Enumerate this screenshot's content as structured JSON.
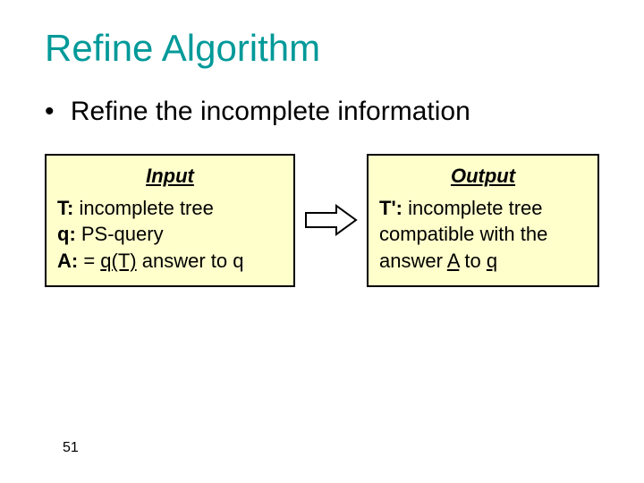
{
  "title": "Refine Algorithm",
  "bullet": "Refine the incomplete information",
  "input": {
    "header": "Input",
    "line1_prefix": "T:",
    "line1_rest": " incomplete tree",
    "line2_prefix": "q:",
    "line2_rest": " PS-query",
    "line3_prefix": "A:",
    "line3_eq": " = ",
    "line3_qT": "q(T)",
    "line3_rest": " answer to q"
  },
  "output": {
    "header": "Output",
    "line1_prefix": "T':",
    "line1_rest": " incomplete tree compatible with the answer ",
    "line1_A": "A",
    "line1_to": " to ",
    "line1_q": "q"
  },
  "page_number": "51"
}
